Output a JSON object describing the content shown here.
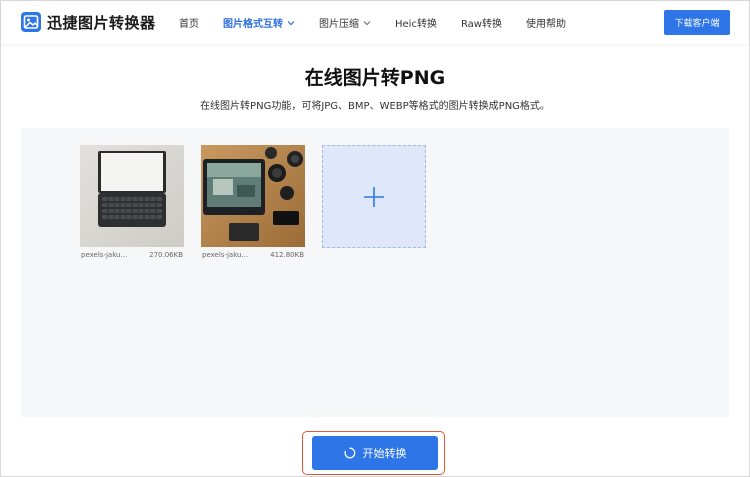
{
  "brand": {
    "name": "迅捷图片转换器"
  },
  "nav": {
    "items": [
      {
        "label": "首页",
        "active": false,
        "dropdown": false
      },
      {
        "label": "图片格式互转",
        "active": true,
        "dropdown": true
      },
      {
        "label": "图片压缩",
        "active": false,
        "dropdown": true
      },
      {
        "label": "Heic转换",
        "active": false,
        "dropdown": false
      },
      {
        "label": "Raw转换",
        "active": false,
        "dropdown": false
      },
      {
        "label": "使用帮助",
        "active": false,
        "dropdown": false
      }
    ],
    "download_label": "下载客户端"
  },
  "hero": {
    "title": "在线图片转PNG",
    "subtitle": "在线图片转PNG功能，可将JPG、BMP、WEBP等格式的图片转换成PNG格式。"
  },
  "files": [
    {
      "name": "pexels-jaku...",
      "size": "270.06KB",
      "thumbnail": "laptop-keyboard-photo"
    },
    {
      "name": "pexels-jaku...",
      "size": "412.80KB",
      "thumbnail": "desk-tablet-camera-photo"
    }
  ],
  "add_tile": {
    "icon": "plus-icon"
  },
  "start_button": {
    "label": "开始转换",
    "icon": "spinner-icon"
  },
  "colors": {
    "accent": "#2e75e8",
    "active_nav": "#2f6fe0",
    "highlight_border": "#e0573c",
    "add_tile_bg": "#dfe8fb",
    "work_area_bg": "#f6f7f9"
  }
}
